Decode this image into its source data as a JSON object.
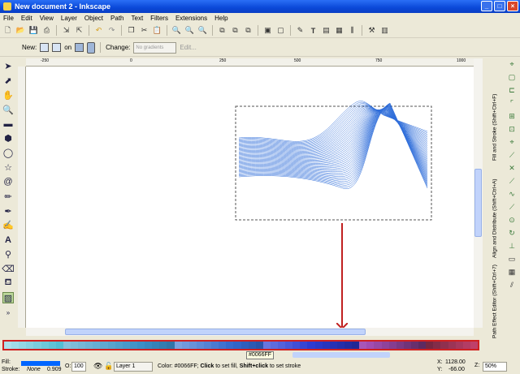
{
  "window": {
    "title": "New document 2 - Inkscape"
  },
  "menubar": [
    "File",
    "Edit",
    "View",
    "Layer",
    "Object",
    "Path",
    "Text",
    "Filters",
    "Extensions",
    "Help"
  ],
  "toolbar2": {
    "new_label": "New:",
    "on_label": "on",
    "change_label": "Change:",
    "gradient_placeholder": "No gradients",
    "edit_label": "Edit..."
  },
  "ruler_ticks": [
    "-250",
    "0",
    "250",
    "500",
    "750",
    "1000"
  ],
  "dock_tabs": [
    "Fill and Stroke (Shift+Ctrl+F)",
    "Align and Distribute (Shift+Ctrl+A)",
    "Path Effect Editor (Shift+Ctrl+7)"
  ],
  "palette": {
    "tooltip": "#0066FF"
  },
  "status": {
    "fill_label": "Fill:",
    "stroke_label": "Stroke:",
    "stroke_value": "None",
    "stroke_width": "0.909",
    "opacity_label": "O:",
    "opacity_value": "100",
    "layer": "Layer 1",
    "message_prefix": "Color: ",
    "message_color": "#0066FF",
    "message_mid": "; ",
    "click_word": "Click",
    "message_click": " to set fill, ",
    "shift_click": "Shift+click",
    "message_end": " to set stroke",
    "x_label": "X:",
    "x_value": "1128.00",
    "y_label": "Y:",
    "y_value": "-66.00",
    "z_label": "Z:",
    "zoom": "50%"
  },
  "colors": {
    "fill": "#0066FF",
    "pattern": "#1a5fd6",
    "accent_red": "#c02020"
  }
}
